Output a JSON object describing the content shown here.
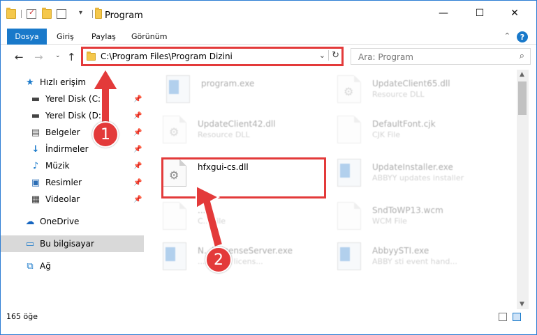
{
  "window": {
    "title": "Program",
    "minimize_glyph": "—",
    "maximize_glyph": "☐",
    "close_glyph": "✕"
  },
  "ribbon": {
    "tabs": [
      "Dosya",
      "Giriş",
      "Paylaş",
      "Görünüm"
    ],
    "help_label": "?"
  },
  "address": {
    "path": "C:\\Program Files\\Program Dizini",
    "search_placeholder": "Ara: Program"
  },
  "sidebar": {
    "items": [
      {
        "label": "Hızlı erişim",
        "icon": "star-icon",
        "pinned": false
      },
      {
        "label": "Yerel Disk (C:)",
        "icon": "drive-icon",
        "pinned": true
      },
      {
        "label": "Yerel Disk (D:)",
        "icon": "drive-icon",
        "pinned": true
      },
      {
        "label": "Belgeler",
        "icon": "documents-icon",
        "pinned": true
      },
      {
        "label": "İndirmeler",
        "icon": "download-icon",
        "pinned": true
      },
      {
        "label": "Müzik",
        "icon": "music-icon",
        "pinned": true
      },
      {
        "label": "Resimler",
        "icon": "pictures-icon",
        "pinned": true
      },
      {
        "label": "Videolar",
        "icon": "video-icon",
        "pinned": true
      },
      {
        "label": "OneDrive",
        "icon": "cloud-icon",
        "pinned": false
      },
      {
        "label": "Bu bilgisayar",
        "icon": "computer-icon",
        "pinned": false,
        "selected": true
      },
      {
        "label": "Ağ",
        "icon": "network-icon",
        "pinned": false
      }
    ]
  },
  "files": [
    {
      "name": "program.exe",
      "type": "",
      "icon": "exe-icon"
    },
    {
      "name": "UpdateClient65.dll",
      "type": "Resource DLL",
      "icon": "dll-icon"
    },
    {
      "name": "UpdateClient42.dll",
      "type": "Resource DLL",
      "icon": "dll-icon"
    },
    {
      "name": "DefaultFont.cjk",
      "type": "CJK File",
      "icon": "file-icon"
    },
    {
      "name": "hfxgui-cs.dll",
      "type": "",
      "icon": "dll-icon",
      "highlighted": true
    },
    {
      "name": "UpdateInstaller.exe",
      "type": "ABBYY updates installer",
      "icon": "app-icon"
    },
    {
      "name": "...k",
      "type": "C... File",
      "icon": "file-icon"
    },
    {
      "name": "SndToWP13.wcm",
      "type": "WCM File",
      "icon": "file-icon"
    },
    {
      "name": "N...kLicenseServer.exe",
      "type": "...etwork licens...",
      "icon": "app-icon"
    },
    {
      "name": "AbbyySTI.exe",
      "type": "ABBY sti event hand...",
      "icon": "app-icon"
    }
  ],
  "status": {
    "item_count": "165 öğe"
  },
  "annotations": {
    "step1": "1",
    "step2": "2",
    "color": "#e33a3a"
  }
}
